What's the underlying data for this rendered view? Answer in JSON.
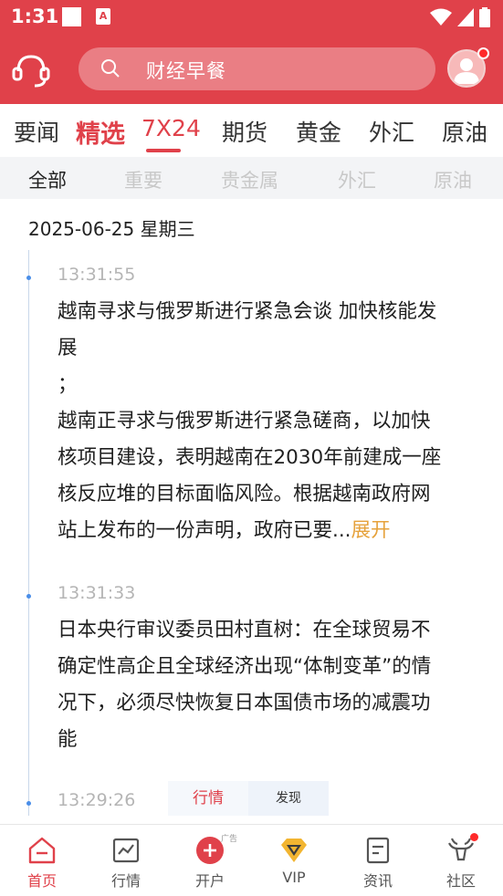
{
  "status_bar": {
    "time": "1:31",
    "a_badge": "A"
  },
  "header": {
    "service_icon": "headset-icon",
    "search": {
      "placeholder": "财经早餐"
    },
    "avatar_icon": "user-avatar-icon"
  },
  "main_tabs": [
    {
      "label": "要闻"
    },
    {
      "label": "精选"
    },
    {
      "label": "7X24",
      "active": true
    },
    {
      "label": "期货"
    },
    {
      "label": "黄金"
    },
    {
      "label": "外汇"
    },
    {
      "label": "原油"
    }
  ],
  "sub_tabs": [
    {
      "label": "全部",
      "active": true
    },
    {
      "label": "重要"
    },
    {
      "label": "贵金属"
    },
    {
      "label": "外汇"
    },
    {
      "label": "原油"
    }
  ],
  "feed": {
    "date": "2025-06-25 星期三",
    "items": [
      {
        "time": "13:31:55",
        "lines": [
          "越南寻求与俄罗斯进行紧急会谈 加快核能发",
          "展",
          "；",
          "越南正寻求与俄罗斯进行紧急磋商，以加快",
          "核项目建设，表明越南在2030年前建成一座",
          "核反应堆的目标面临风险。根据越南政府网",
          "站上发布的一份声明，政府已要..."
        ],
        "expand_label": "展开"
      },
      {
        "time": "13:31:33",
        "lines": [
          "日本央行审议委员田村直树：在全球贸易不",
          "确定性高企且全球经济出现“体制变革”的情",
          "况下，必须尽快恢复日本国债市场的减震功",
          "能"
        ]
      },
      {
        "time": "13:29:26"
      }
    ]
  },
  "float_tabs": [
    {
      "label": "行情",
      "active": true
    },
    {
      "label": "发现"
    }
  ],
  "bottom_nav": [
    {
      "label": "首页",
      "icon": "home-icon",
      "active": true
    },
    {
      "label": "行情",
      "icon": "chart-icon"
    },
    {
      "label": "开户",
      "icon": "plus-circle-icon",
      "ad_tag": "广告"
    },
    {
      "label": "VIP",
      "icon": "vip-diamond-icon"
    },
    {
      "label": "资讯",
      "icon": "document-icon"
    },
    {
      "label": "社区",
      "icon": "community-icon"
    }
  ],
  "colors": {
    "brand": "#e0414a",
    "expand": "#e6a23c",
    "timeline_dot": "#4a8ee8"
  }
}
